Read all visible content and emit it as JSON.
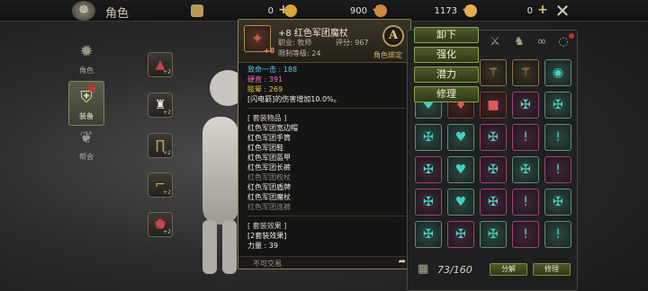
{
  "topbar": {
    "title": "角色",
    "logo_icon": "dragon-emblem",
    "resources": [
      {
        "icon": "scroll-ticket-icon",
        "value": "0",
        "color": "#b99a5a"
      },
      {
        "icon": "gold-coin-icon",
        "value": "900",
        "color": "#d9a53a"
      },
      {
        "icon": "bronze-coin-icon",
        "value": "1173",
        "color": "#c78a40"
      },
      {
        "icon": "gem-coin-icon",
        "value": "0",
        "color": "#e0b050"
      }
    ],
    "plus_label": "+",
    "close_icon": "close-x-icon"
  },
  "nav": [
    {
      "label": "角色",
      "icon": "gear-emblem-icon",
      "active": false
    },
    {
      "label": "装备",
      "icon": "shield-emblem-icon",
      "active": true
    },
    {
      "label": "帮会",
      "icon": "wolf-emblem-icon",
      "active": false
    }
  ],
  "equipment_slots": [
    {
      "name": "hat",
      "level": "+2"
    },
    {
      "name": "top",
      "level": "+2"
    },
    {
      "name": "pants",
      "level": "+2"
    },
    {
      "name": "boots",
      "level": "+2"
    },
    {
      "name": "shield",
      "level": "+2"
    }
  ],
  "tooltip": {
    "item_name": "+8 红色军团魔杖",
    "upgrade": "+8",
    "job": "职业: 牧师",
    "score": "评分: 967",
    "required_level": "限制等级: 24",
    "grade": "A",
    "bind_status": "角色绑定",
    "stats": [
      {
        "text": "致命一击 : 188",
        "color": "cyan"
      },
      {
        "text": "硬直 : 391",
        "color": "pink"
      },
      {
        "text": "眩晕 : 269",
        "color": "yellow"
      },
      {
        "text": "[闪电箭]的伤害增加10.0%。",
        "color": "white"
      }
    ],
    "set_title": "[ 套装物品 ]",
    "set_items": [
      {
        "text": "红色军团宽边帽",
        "owned": true
      },
      {
        "text": "红色军团手筒",
        "owned": true
      },
      {
        "text": "红色军团鞋",
        "owned": true
      },
      {
        "text": "红色军团盔甲",
        "owned": true
      },
      {
        "text": "红色军团长裤",
        "owned": true
      },
      {
        "text": "红色军团权杖",
        "owned": false
      },
      {
        "text": "红色军团盾牌",
        "owned": true
      },
      {
        "text": "红色军团魔杖",
        "owned": true
      },
      {
        "text": "红色军团连裤",
        "owned": false
      }
    ],
    "set_effect_title": "[ 套装效果 ]",
    "set_effect_tier": "[2套装效果]",
    "set_effect_stat": "力量 : 39",
    "trade_status": "不可交易",
    "share_icon": "share-arrow-icon"
  },
  "actions": {
    "unequip": "卸下",
    "enhance": "强化",
    "potential": "潜力",
    "repair": "修理"
  },
  "inventory": {
    "tabs": [
      {
        "icon": "all-items-icon"
      },
      {
        "icon": "weapon-tab-icon"
      },
      {
        "icon": "armor-tab-icon"
      },
      {
        "icon": "accessory-tab-icon"
      },
      {
        "icon": "misc-tab-icon"
      }
    ],
    "count": "73/160",
    "decompose_label": "分解",
    "repair_label": "修理",
    "grid_icon": "sort-grid-icon"
  }
}
